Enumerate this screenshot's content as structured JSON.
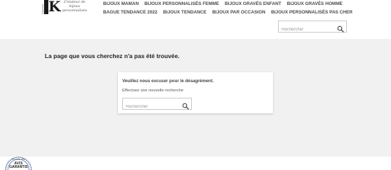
{
  "logo": {
    "side_text": "bijouterie",
    "monogram": "K",
    "tagline": "Créateur de bijoux personnalisés"
  },
  "nav": {
    "row1": [
      "Bijoux Maman",
      "Bijoux Personnalisés Femme",
      "Bijoux Gravés Enfant",
      "Bijoux Gravés Homme"
    ],
    "row2": [
      "Bague Tendance 2022",
      "Bijoux Tendance",
      "Bijoux Par Occasion",
      "Bijoux Personnalisés Pas Cher"
    ]
  },
  "header_search": {
    "placeholder": "Rechercher"
  },
  "main": {
    "title": "La page que vous cherchez n'a pas été trouvée.",
    "card": {
      "title": "Veuillez nous excuser pour le désagrément.",
      "text": "Effectuez une nouvelle recherche",
      "search_placeholder": "Rechercher"
    }
  },
  "footer": {
    "badge": {
      "small": "Société des",
      "line1": "AVIS",
      "line2": "GARANTIS"
    }
  },
  "colors": {
    "background": "#f1f1f1",
    "nav_text": "#4a4a4a",
    "badge_ring": "#2b4a8b"
  },
  "icons": [
    "search-icon",
    "badge-laurel-icon"
  ]
}
